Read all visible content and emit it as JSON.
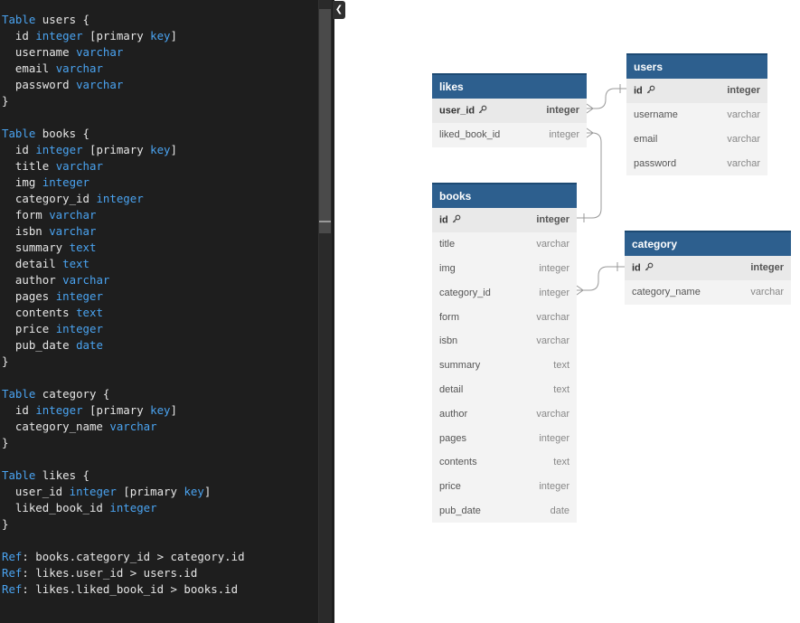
{
  "editor": {
    "collapse_icon": "chevron-left-icon",
    "lines": [
      {
        "t": [
          [
            "Table",
            "kw"
          ],
          [
            " users {",
            ""
          ]
        ]
      },
      {
        "t": [
          [
            "  id ",
            ""
          ],
          [
            "integer",
            "kw"
          ],
          [
            " [primary ",
            ""
          ],
          [
            "key",
            "kw"
          ],
          [
            "]",
            ""
          ]
        ]
      },
      {
        "t": [
          [
            "  username ",
            ""
          ],
          [
            "varchar",
            "kw"
          ]
        ]
      },
      {
        "t": [
          [
            "  email ",
            ""
          ],
          [
            "varchar",
            "kw"
          ]
        ]
      },
      {
        "t": [
          [
            "  password ",
            ""
          ],
          [
            "varchar",
            "kw"
          ]
        ]
      },
      {
        "t": [
          [
            "}",
            ""
          ]
        ]
      },
      {
        "t": []
      },
      {
        "t": [
          [
            "Table",
            "kw"
          ],
          [
            " books {",
            ""
          ]
        ]
      },
      {
        "t": [
          [
            "  id ",
            ""
          ],
          [
            "integer",
            "kw"
          ],
          [
            " [primary ",
            ""
          ],
          [
            "key",
            "kw"
          ],
          [
            "]",
            ""
          ]
        ]
      },
      {
        "t": [
          [
            "  title ",
            ""
          ],
          [
            "varchar",
            "kw"
          ]
        ]
      },
      {
        "t": [
          [
            "  img ",
            ""
          ],
          [
            "integer",
            "kw"
          ]
        ]
      },
      {
        "t": [
          [
            "  category_id ",
            ""
          ],
          [
            "integer",
            "kw"
          ]
        ]
      },
      {
        "t": [
          [
            "  form ",
            ""
          ],
          [
            "varchar",
            "kw"
          ]
        ]
      },
      {
        "t": [
          [
            "  isbn ",
            ""
          ],
          [
            "varchar",
            "kw"
          ]
        ]
      },
      {
        "t": [
          [
            "  summary ",
            ""
          ],
          [
            "text",
            "kw"
          ]
        ]
      },
      {
        "t": [
          [
            "  detail ",
            ""
          ],
          [
            "text",
            "kw"
          ]
        ]
      },
      {
        "t": [
          [
            "  author ",
            ""
          ],
          [
            "varchar",
            "kw"
          ]
        ]
      },
      {
        "t": [
          [
            "  pages ",
            ""
          ],
          [
            "integer",
            "kw"
          ]
        ]
      },
      {
        "t": [
          [
            "  contents ",
            ""
          ],
          [
            "text",
            "kw"
          ]
        ]
      },
      {
        "t": [
          [
            "  price ",
            ""
          ],
          [
            "integer",
            "kw"
          ]
        ]
      },
      {
        "t": [
          [
            "  pub_date ",
            ""
          ],
          [
            "date",
            "kw"
          ]
        ]
      },
      {
        "t": [
          [
            "}",
            ""
          ]
        ]
      },
      {
        "t": []
      },
      {
        "t": [
          [
            "Table",
            "kw"
          ],
          [
            " category {",
            ""
          ]
        ]
      },
      {
        "t": [
          [
            "  id ",
            ""
          ],
          [
            "integer",
            "kw"
          ],
          [
            " [primary ",
            ""
          ],
          [
            "key",
            "kw"
          ],
          [
            "]",
            ""
          ]
        ]
      },
      {
        "t": [
          [
            "  category_name ",
            ""
          ],
          [
            "varchar",
            "kw"
          ]
        ]
      },
      {
        "t": [
          [
            "}",
            ""
          ]
        ]
      },
      {
        "t": []
      },
      {
        "t": [
          [
            "Table",
            "kw"
          ],
          [
            " likes {",
            ""
          ]
        ]
      },
      {
        "t": [
          [
            "  user_id ",
            ""
          ],
          [
            "integer",
            "kw"
          ],
          [
            " [primary ",
            ""
          ],
          [
            "key",
            "kw"
          ],
          [
            "]",
            ""
          ]
        ]
      },
      {
        "t": [
          [
            "  liked_book_id ",
            ""
          ],
          [
            "integer",
            "kw"
          ]
        ]
      },
      {
        "t": [
          [
            "}",
            ""
          ]
        ]
      },
      {
        "t": []
      },
      {
        "t": [
          [
            "Ref",
            "kw"
          ],
          [
            ": books.category_id > category.id",
            ""
          ]
        ]
      },
      {
        "t": [
          [
            "Ref",
            "kw"
          ],
          [
            ": likes.user_id > users.id",
            ""
          ]
        ]
      },
      {
        "t": [
          [
            "Ref",
            "kw"
          ],
          [
            ": likes.liked_book_id > books.id",
            ""
          ]
        ]
      }
    ]
  },
  "diagram": {
    "colors": {
      "header": "#2d5f8e",
      "body": "#f3f3f3",
      "connector": "#999999"
    },
    "pk_icon": "key-icon",
    "tables": {
      "likes": {
        "name": "likes",
        "columns": [
          {
            "name": "user_id",
            "type": "integer",
            "pk": true
          },
          {
            "name": "liked_book_id",
            "type": "integer",
            "pk": false
          }
        ]
      },
      "users": {
        "name": "users",
        "columns": [
          {
            "name": "id",
            "type": "integer",
            "pk": true
          },
          {
            "name": "username",
            "type": "varchar",
            "pk": false
          },
          {
            "name": "email",
            "type": "varchar",
            "pk": false
          },
          {
            "name": "password",
            "type": "varchar",
            "pk": false
          }
        ]
      },
      "books": {
        "name": "books",
        "columns": [
          {
            "name": "id",
            "type": "integer",
            "pk": true
          },
          {
            "name": "title",
            "type": "varchar",
            "pk": false
          },
          {
            "name": "img",
            "type": "integer",
            "pk": false
          },
          {
            "name": "category_id",
            "type": "integer",
            "pk": false
          },
          {
            "name": "form",
            "type": "varchar",
            "pk": false
          },
          {
            "name": "isbn",
            "type": "varchar",
            "pk": false
          },
          {
            "name": "summary",
            "type": "text",
            "pk": false
          },
          {
            "name": "detail",
            "type": "text",
            "pk": false
          },
          {
            "name": "author",
            "type": "varchar",
            "pk": false
          },
          {
            "name": "pages",
            "type": "integer",
            "pk": false
          },
          {
            "name": "contents",
            "type": "text",
            "pk": false
          },
          {
            "name": "price",
            "type": "integer",
            "pk": false
          },
          {
            "name": "pub_date",
            "type": "date",
            "pk": false
          }
        ]
      },
      "category": {
        "name": "category",
        "columns": [
          {
            "name": "id",
            "type": "integer",
            "pk": true
          },
          {
            "name": "category_name",
            "type": "varchar",
            "pk": false
          }
        ]
      }
    }
  }
}
